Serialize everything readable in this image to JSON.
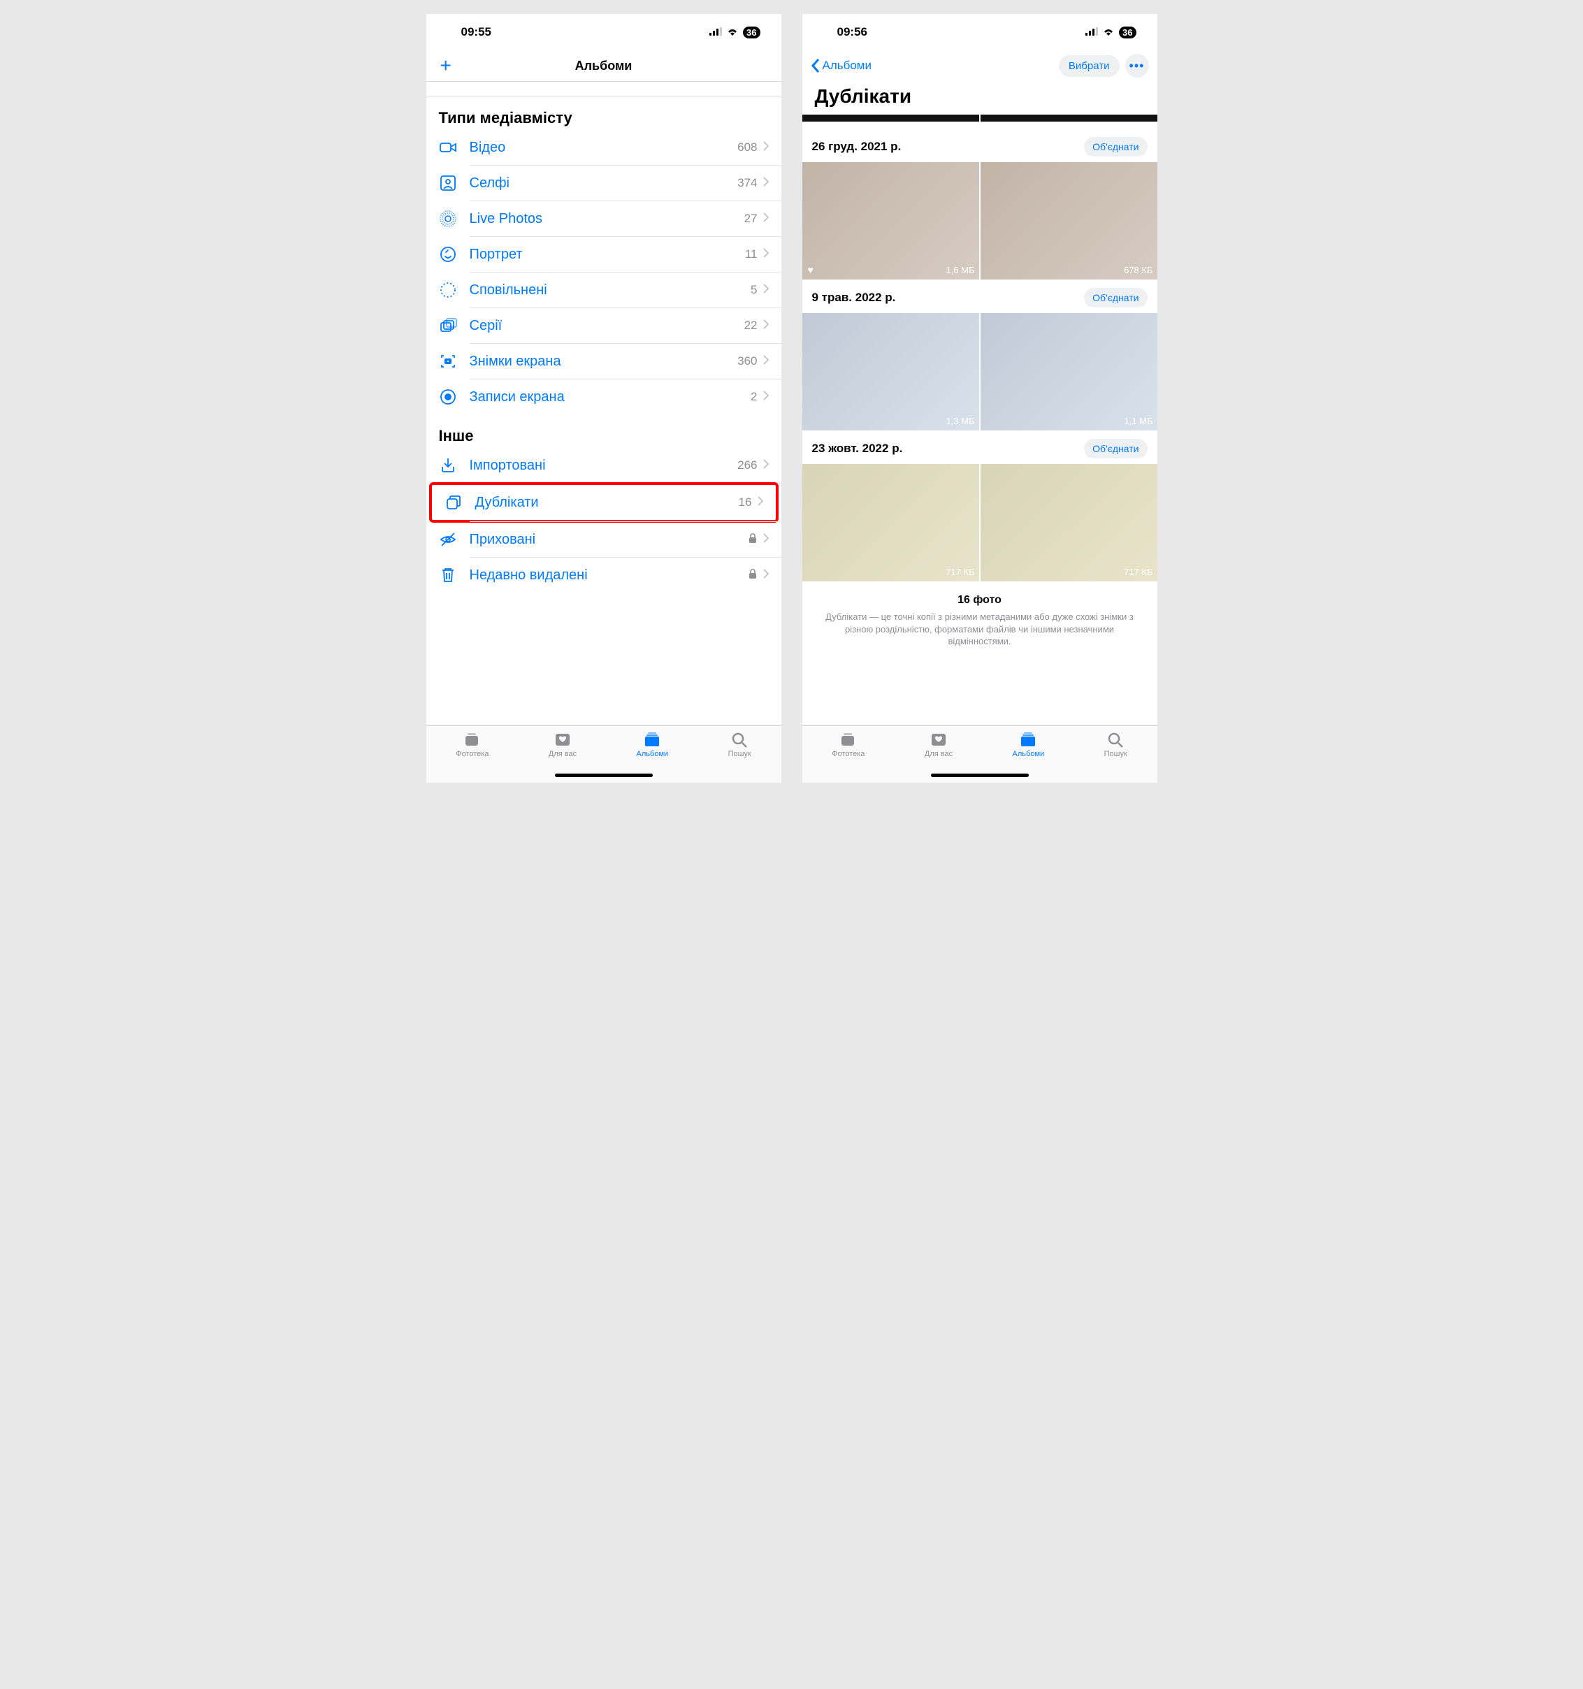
{
  "left": {
    "statusbar": {
      "time": "09:55",
      "battery": "36"
    },
    "navbar": {
      "title": "Альбоми"
    },
    "sections": {
      "media": {
        "title": "Типи медіавмісту",
        "items": [
          {
            "label": "Відео",
            "count": "608"
          },
          {
            "label": "Селфі",
            "count": "374"
          },
          {
            "label": "Live Photos",
            "count": "27"
          },
          {
            "label": "Портрет",
            "count": "11"
          },
          {
            "label": "Сповільнені",
            "count": "5"
          },
          {
            "label": "Серії",
            "count": "22"
          },
          {
            "label": "Знімки екрана",
            "count": "360"
          },
          {
            "label": "Записи екрана",
            "count": "2"
          }
        ]
      },
      "other": {
        "title": "Інше",
        "items": [
          {
            "label": "Імпортовані",
            "count": "266"
          },
          {
            "label": "Дублікати",
            "count": "16"
          },
          {
            "label": "Приховані"
          },
          {
            "label": "Недавно видалені"
          }
        ]
      }
    },
    "tabs": [
      "Фототека",
      "Для вас",
      "Альбоми",
      "Пошук"
    ]
  },
  "right": {
    "statusbar": {
      "time": "09:56",
      "battery": "36"
    },
    "navbar": {
      "back": "Альбоми",
      "select": "Вибрати"
    },
    "title": "Дублікати",
    "groups": [
      {
        "date": "26 груд. 2021 р.",
        "merge": "Об'єднати",
        "thumbs": [
          {
            "size": "1,6 МБ",
            "fav": true
          },
          {
            "size": "678 КБ"
          }
        ]
      },
      {
        "date": "9 трав. 2022 р.",
        "merge": "Об'єднати",
        "thumbs": [
          {
            "size": "1,3 МБ"
          },
          {
            "size": "1,1 МБ"
          }
        ]
      },
      {
        "date": "23 жовт. 2022 р.",
        "merge": "Об'єднати",
        "thumbs": [
          {
            "size": "717 КБ"
          },
          {
            "size": "717 КБ"
          }
        ]
      }
    ],
    "footer": {
      "count": "16 фото",
      "desc": "Дублікати — це точні копії з різними метаданими або дуже схожі знімки з різною роздільністю, форматами файлів чи іншими незначними відмінностями."
    },
    "tabs": [
      "Фототека",
      "Для вас",
      "Альбоми",
      "Пошук"
    ]
  }
}
